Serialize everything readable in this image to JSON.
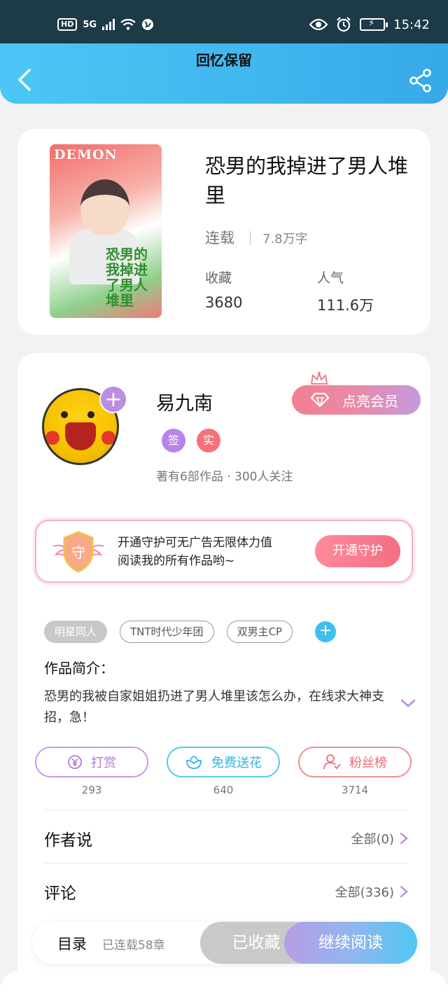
{
  "status_bar": {
    "hd": "HD",
    "network": "5G",
    "time": "15:42"
  },
  "header": {
    "title": "回忆保留"
  },
  "book": {
    "cover_title": "DEMON",
    "cover_text": "恐男的我掉进了男人堆里",
    "title": "恐男的我掉进了男人堆里",
    "status": "连载",
    "word_count": "7.8万字",
    "favorites_label": "收藏",
    "favorites_value": "3680",
    "popularity_label": "人气",
    "popularity_value": "111.6万"
  },
  "author": {
    "name": "易九南",
    "badge_sign": "签",
    "badge_real": "实",
    "meta": "著有6部作品 · 300人关注",
    "vip_button": "点亮会员",
    "follow_symbol": "+"
  },
  "guard": {
    "icon_text": "守",
    "line1": "开通守护可无广告无限体力值",
    "line2": "阅读我的所有作品哟~",
    "button": "开通守护"
  },
  "tags": [
    "明星同人",
    "TNT时代少年团",
    "双男主CP"
  ],
  "tag_add_symbol": "+",
  "intro": {
    "title": "作品简介：",
    "text": "恐男的我被自家姐姐扔进了男人堆里该怎么办，在线求大神支招，急！"
  },
  "actions": {
    "reward": {
      "label": "打赏",
      "count": "293",
      "icon": "yen-coin-icon"
    },
    "flower": {
      "label": "免费送花",
      "count": "640",
      "icon": "flower-icon"
    },
    "fans": {
      "label": "粉丝榜",
      "count": "3714",
      "icon": "user-icon"
    }
  },
  "author_says": {
    "title": "作者说",
    "link": "全部(0)"
  },
  "comments": {
    "title": "评论",
    "link": "全部(336)"
  },
  "bottom_bar": {
    "toc": "目录",
    "chapters": "已连载58章",
    "collected": "已收藏",
    "continue": "继续阅读"
  },
  "colors": {
    "header_gradient_start": "#4cc7f5",
    "header_gradient_end": "#36a9e8",
    "purple_accent": "#b884e6",
    "pink_accent": "#f46d84",
    "blue_accent": "#3fc0ef"
  }
}
